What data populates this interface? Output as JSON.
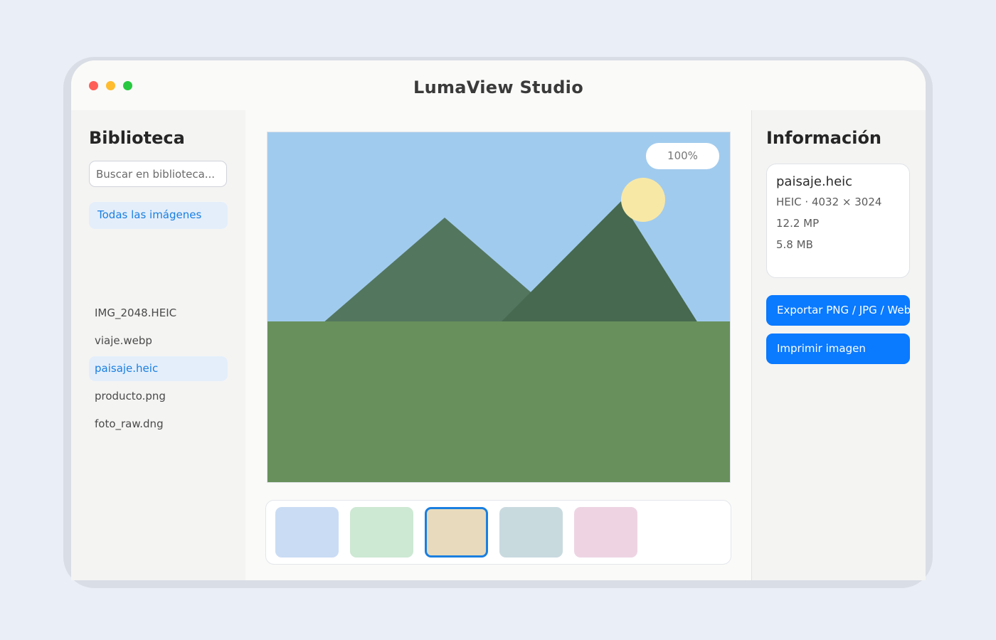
{
  "window": {
    "title": "LumaView Studio"
  },
  "sidebar": {
    "heading": "Biblioteca",
    "search_placeholder": "Buscar en biblioteca...",
    "all_images_label": "Todas las imágenes",
    "files": [
      {
        "name": "IMG_2048.HEIC",
        "selected": false
      },
      {
        "name": "viaje.webp",
        "selected": false
      },
      {
        "name": "paisaje.heic",
        "selected": true
      },
      {
        "name": "producto.png",
        "selected": false
      },
      {
        "name": "foto_raw.dng",
        "selected": false
      }
    ]
  },
  "viewer": {
    "zoom": "100%",
    "scene_colors": {
      "sky": "#a1cbee",
      "mountain_left": "#53765f",
      "mountain_right": "#46694f",
      "ground": "#68905c",
      "sun": "#f8e8a6"
    }
  },
  "thumbnails": [
    {
      "color": "#cadcf4",
      "selected": false
    },
    {
      "color": "#cde8d3",
      "selected": false
    },
    {
      "color": "#e8dbbd",
      "selected": true
    },
    {
      "color": "#c9dadf",
      "selected": false
    },
    {
      "color": "#eed4e3",
      "selected": false
    }
  ],
  "info": {
    "heading": "Información",
    "file_name": "paisaje.heic",
    "format_dims": "HEIC · 4032 × 3024",
    "megapixels": "12.2 MP",
    "size": "5.8 MB",
    "export_label": "Exportar PNG / JPG / WebP",
    "print_label": "Imprimir imagen"
  },
  "colors": {
    "accent": "#0a7aff",
    "selected_text": "#1a7fe0",
    "selected_bg": "#e4eefb"
  }
}
